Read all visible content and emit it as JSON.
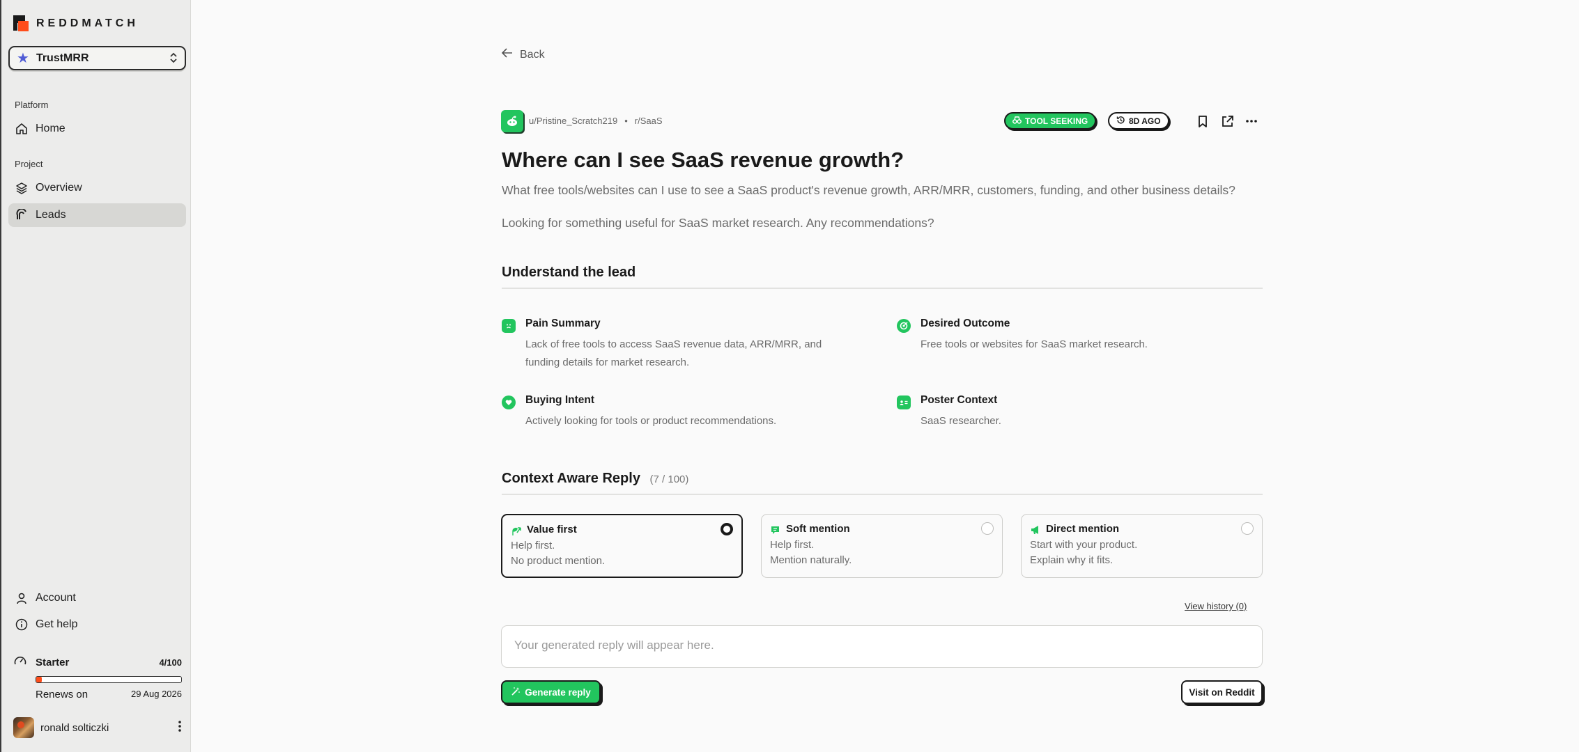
{
  "brand": {
    "name": "REDDMATCH"
  },
  "project": {
    "name": "TrustMRR"
  },
  "sidebar": {
    "platform_label": "Platform",
    "project_label": "Project",
    "items": [
      {
        "label": "Home",
        "icon": "home-icon"
      },
      {
        "label": "Overview",
        "icon": "layers-icon"
      },
      {
        "label": "Leads",
        "icon": "magnet-icon",
        "active": true
      }
    ],
    "bottom": [
      {
        "label": "Account",
        "icon": "user-icon"
      },
      {
        "label": "Get help",
        "icon": "info-icon"
      }
    ],
    "plan": {
      "name": "Starter",
      "count": "4/100",
      "usage_fraction": 0.04,
      "renew_label": "Renews on",
      "renew_date": "29 Aug 2026"
    },
    "user": {
      "name": "ronald solticzki"
    }
  },
  "nav": {
    "back_label": "Back"
  },
  "post": {
    "author": "u/Pristine_Scratch219",
    "separator": "•",
    "subreddit": "r/SaaS",
    "tag": "TOOL SEEKING",
    "age": "8D AGO",
    "title": "Where can I see SaaS revenue growth?",
    "body_1": "What free tools/websites can I use to see a SaaS product's revenue growth, ARR/MRR, customers, funding, and other business details?",
    "body_2": "Looking for something useful for SaaS market research. Any recommendations?"
  },
  "understand": {
    "title": "Understand the lead",
    "pain": {
      "label": "Pain Summary",
      "text": "Lack of free tools to access SaaS revenue data, ARR/MRR, and funding details for market research."
    },
    "outcome": {
      "label": "Desired Outcome",
      "text": "Free tools or websites for SaaS market research."
    },
    "intent": {
      "label": "Buying Intent",
      "text": "Actively looking for tools or product recommendations."
    },
    "context": {
      "label": "Poster Context",
      "text": "SaaS researcher."
    }
  },
  "reply": {
    "title": "Context Aware Reply",
    "counter": "(7 / 100)",
    "options": [
      {
        "label": "Value first",
        "line1": "Help first.",
        "line2": "No product mention.",
        "selected": true
      },
      {
        "label": "Soft mention",
        "line1": "Help first.",
        "line2": "Mention naturally.",
        "selected": false
      },
      {
        "label": "Direct mention",
        "line1": "Start with your product.",
        "line2": "Explain why it fits.",
        "selected": false
      }
    ],
    "history_label": "View history (0)",
    "output_placeholder": "Your generated reply will appear here.",
    "generate_label": "Generate reply",
    "visit_label": "Visit on Reddit"
  },
  "colors": {
    "accent": "#22c55e",
    "plan_fill": "#ff4d1a",
    "star": "#4f5bd5"
  }
}
